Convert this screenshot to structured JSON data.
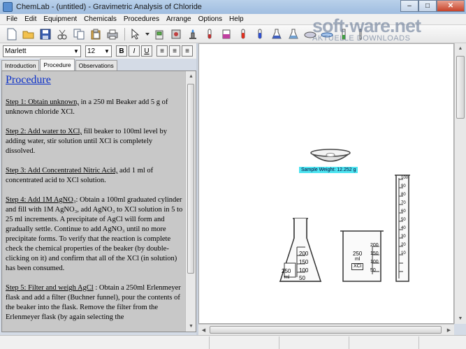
{
  "window": {
    "title": "ChemLab - (untitled) - Gravimetric Analysis of Chloride",
    "controls": {
      "minimize": "–",
      "maximize": "□",
      "close": "✕"
    }
  },
  "menu": [
    "File",
    "Edit",
    "Equipment",
    "Chemicals",
    "Procedures",
    "Arrange",
    "Options",
    "Help"
  ],
  "toolbar": {
    "icons": [
      {
        "name": "new-icon",
        "glyph": "🗋"
      },
      {
        "name": "open-icon",
        "glyph": "📂"
      },
      {
        "name": "save-icon",
        "glyph": "💾"
      },
      {
        "name": "cut-icon",
        "glyph": "✂"
      },
      {
        "name": "copy-icon",
        "glyph": "⎘"
      },
      {
        "name": "paste-icon",
        "glyph": "📋"
      },
      {
        "name": "print-icon",
        "glyph": "🖶"
      },
      {
        "name": "burner-icon",
        "glyph": "♨"
      },
      {
        "name": "test-tube-icon",
        "glyph": "⚗"
      },
      {
        "name": "beaker-icon",
        "glyph": "🧪"
      },
      {
        "name": "flask-icon",
        "glyph": "⚗"
      },
      {
        "name": "dish-icon",
        "glyph": "◡"
      }
    ]
  },
  "watermark": {
    "main": "soft·ware.net",
    "sub": "AKTUELLE DOWNLOADS"
  },
  "format": {
    "font": "Marlett",
    "size": "12",
    "bold": "B",
    "italic": "I",
    "underline": "U",
    "align_left": "≡",
    "align_center": "≡",
    "align_right": "≡"
  },
  "tabs": [
    "Introduction",
    "Procedure",
    "Observations"
  ],
  "procedure": {
    "heading": "Procedure",
    "steps": [
      {
        "label": "Step 1: Obtain unknown,",
        "text": " in a 250 ml Beaker add 5 g of unknown chloride XCl."
      },
      {
        "label": "Step 2: Add water to XCl,",
        "text": "  fill beaker to 100ml level by adding water, stir solution until XCl is completely dissolved."
      },
      {
        "label": "Step 3: Add Concentrated Nitric Acid,",
        "text": " add 1 ml of concentrated acid to XCl solution."
      },
      {
        "label": "Step 4: Add 1M AgNO₃",
        "text": ":  Obtain a 100ml graduated cylinder and fill with 1M AgNO₃, add AgNO₃ to XCl solution in 5 to 25 ml increments. A precipitate of AgCl will form and gradually settle. Continue to add AgNO₃ until no more precipitate forms. To verify that the reaction is complete check the chemical properties of the beaker (by double-clicking on it) and confirm that all of the XCl (in solution) has been consumed."
      },
      {
        "label": "Step 5:  Filter and weigh AgCl",
        "text": " : Obtain  a 250ml Erlenmeyer flask and add a filter (Buchner funnel), pour the contents of the beaker into the flask. Remove the filter from the Erlenmeyer flask  (by again selecting the"
      }
    ]
  },
  "lab": {
    "sample_weight_label": "Sample Weight:  12.252 g",
    "flask": {
      "volume": "250",
      "unit": "ml",
      "ticks": [
        "200",
        "150",
        "100",
        "50"
      ]
    },
    "beaker": {
      "volume": "250",
      "unit": "ml",
      "content": "XCl",
      "ticks": [
        "200",
        "150",
        "100",
        "50"
      ]
    },
    "cylinder": {
      "ticks": [
        "100",
        "90",
        "80",
        "70",
        "60",
        "50",
        "40",
        "30",
        "20",
        "10"
      ]
    }
  }
}
